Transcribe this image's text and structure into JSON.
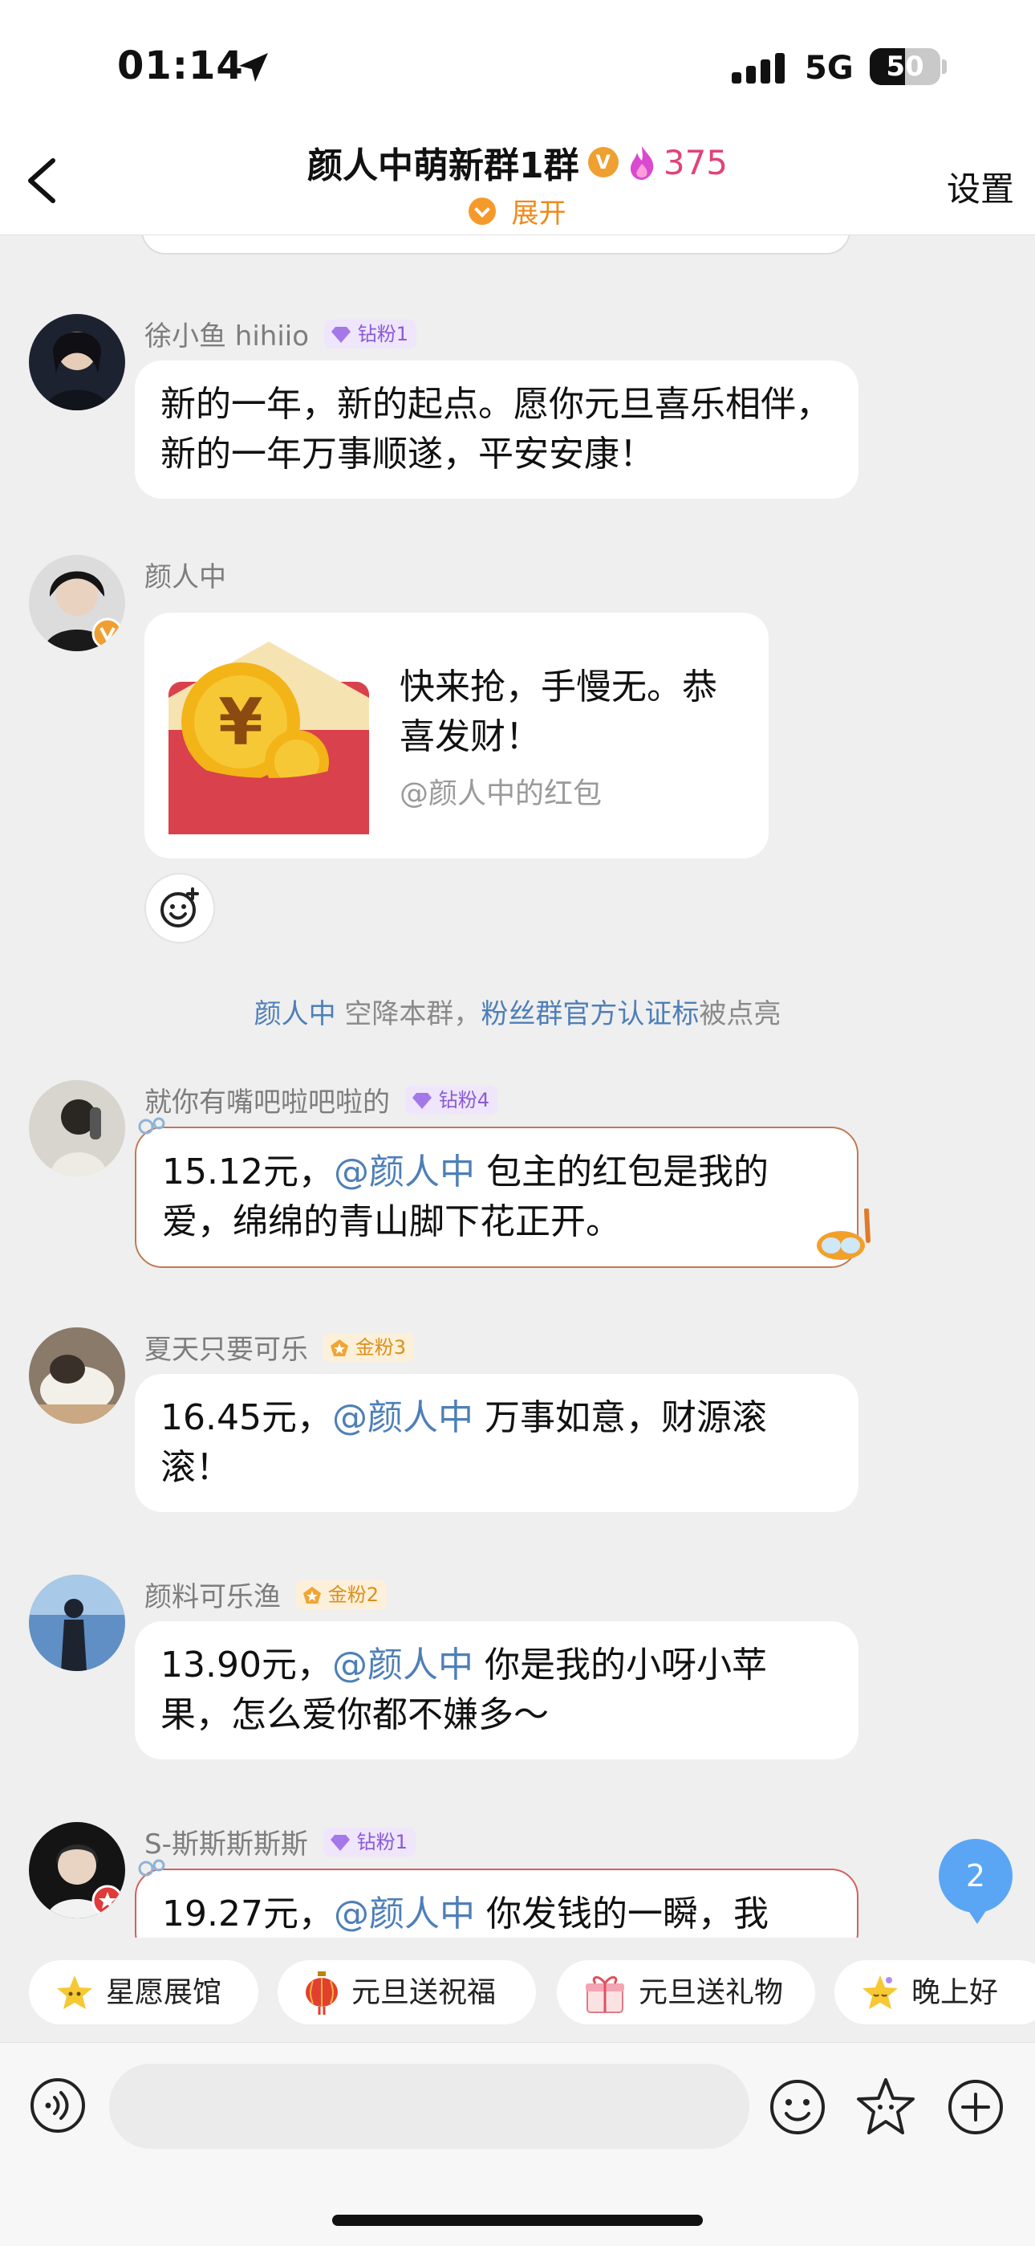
{
  "status_bar": {
    "time": "01:14",
    "network": "5G",
    "battery": "50",
    "battery_level": 0.5
  },
  "header": {
    "title": "颜人中萌新群1群",
    "verified_badge": "V",
    "heat_value": "375",
    "expand_label": "展开",
    "settings_label": "设置"
  },
  "messages": [
    {
      "sender": "徐小鱼 hihiio",
      "badge": "钻粉1",
      "badge_type": "diamond",
      "text": "新的一年，新的起点。愿你元旦喜乐相伴，新的一年万事顺遂，平安安康！"
    },
    {
      "sender": "颜人中",
      "red_packet": {
        "text": "快来抢，手慢无。恭喜发财！",
        "sub": "@颜人中的红包"
      }
    },
    {
      "sender": "就你有嘴吧啦吧啦的",
      "badge": "钻粉4",
      "badge_type": "diamond",
      "amount": "15.12元，",
      "mention": "@颜人中",
      "text": " 包主的红包是我的爱，绵绵的青山脚下花正开。"
    },
    {
      "sender": "夏天只要可乐",
      "badge": "金粉3",
      "badge_type": "gold",
      "amount": "16.45元，",
      "mention": "@颜人中",
      "text": " 万事如意，财源滚滚！"
    },
    {
      "sender": "颜料可乐渔",
      "badge": "金粉2",
      "badge_type": "gold",
      "amount": "13.90元，",
      "mention": "@颜人中",
      "text": " 你是我的小呀小苹果，怎么爱你都不嫌多～"
    },
    {
      "sender": "S-斯斯斯斯斯",
      "badge": "钻粉1",
      "badge_type": "diamond",
      "amount": "19.27元，",
      "mention": "@颜人中",
      "text": " 你发钱的一瞬，我"
    }
  ],
  "system_notice": {
    "user": "颜人中",
    "middle": " 空降本群，",
    "link": "粉丝群官方认证标",
    "suffix": "被点亮"
  },
  "unread_count": "2",
  "quick_chips": [
    "星愿展馆",
    "元旦送祝福",
    "元旦送礼物",
    "晚上好"
  ],
  "input": {
    "placeholder": ""
  },
  "colors": {
    "mention": "#4e7fb8",
    "heat": "#e0437a",
    "expand": "#ee8a1c",
    "unread": "#5aa6f5"
  }
}
